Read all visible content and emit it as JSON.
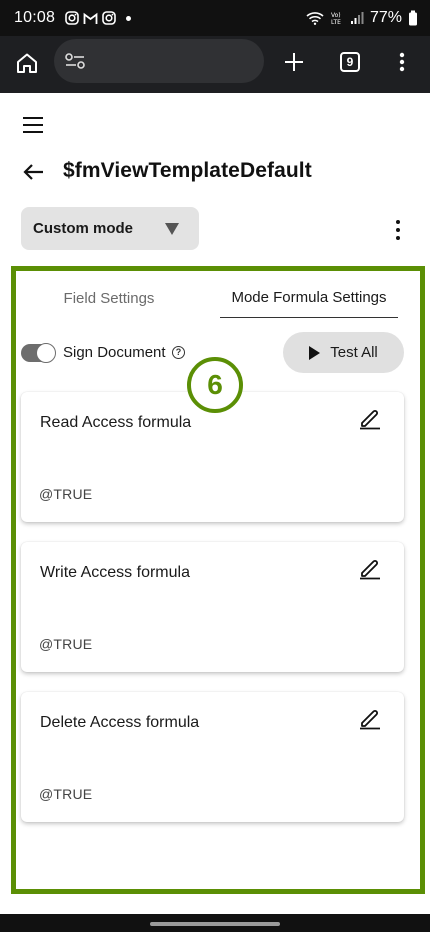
{
  "status_bar": {
    "time": "10:08",
    "battery": "77%",
    "icons": [
      "instagram-icon",
      "gmail-icon",
      "instagram-icon",
      "notification-dot",
      "wifi-icon",
      "volte-icon",
      "signal-icon",
      "battery-icon"
    ]
  },
  "browser": {
    "tabs_count": "9",
    "icons": [
      "home-icon",
      "site-settings-icon",
      "plus-icon",
      "tabs-icon",
      "more-vert-icon"
    ]
  },
  "app": {
    "title": "$fmViewTemplateDefault",
    "mode_select": {
      "selected": "Custom mode"
    }
  },
  "tabs": [
    {
      "label": "Field Settings",
      "active": false
    },
    {
      "label": "Mode Formula Settings",
      "active": true
    }
  ],
  "sign_document": {
    "label": "Sign Document",
    "enabled": true
  },
  "test_all": {
    "label": "Test All"
  },
  "annotation": {
    "step": "6",
    "color": "#5b8f05"
  },
  "formulas": [
    {
      "title": "Read Access formula",
      "value": "@TRUE"
    },
    {
      "title": "Write Access formula",
      "value": "@TRUE"
    },
    {
      "title": "Delete Access formula",
      "value": "@TRUE"
    }
  ]
}
